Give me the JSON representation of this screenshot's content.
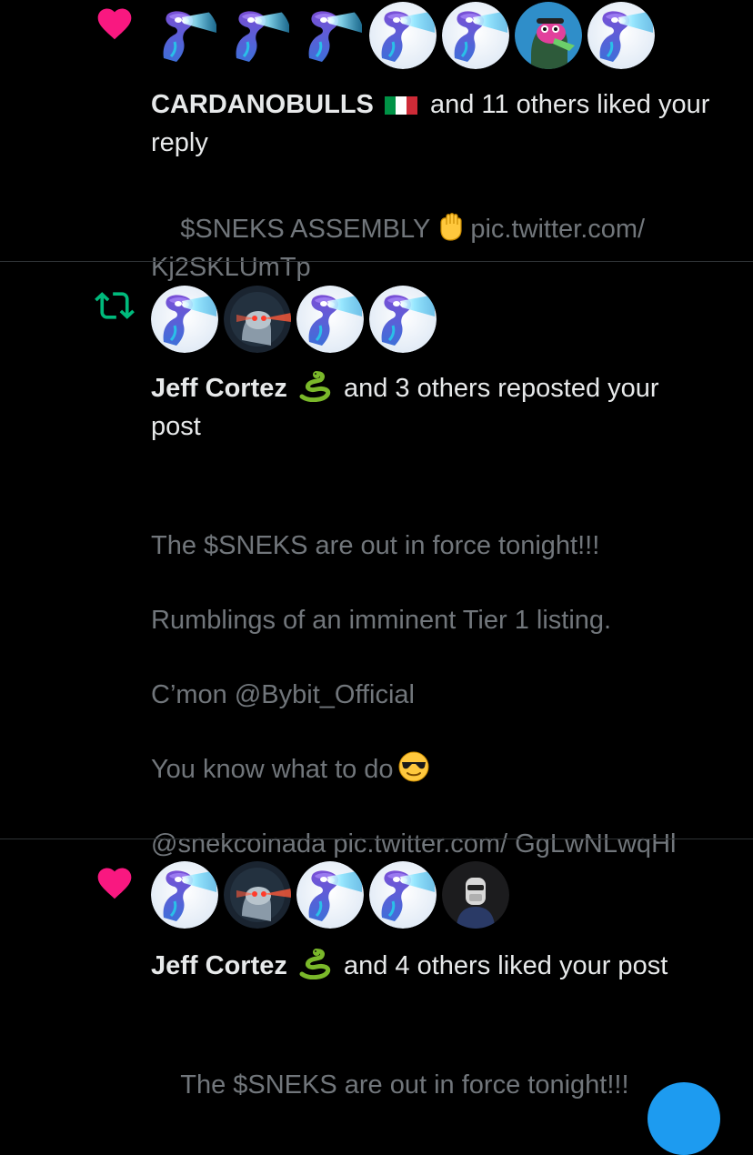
{
  "colors": {
    "background": "#000000",
    "primary_text": "#e7e9ea",
    "secondary_text": "#71767b",
    "like": "#f91880",
    "repost": "#00ba7c",
    "divider": "#2f3336"
  },
  "notifications": [
    {
      "type": "like",
      "icon": "heart-icon",
      "avatars": [
        "snake-eyes-avatar",
        "snake-eyes-avatar",
        "snake-eyes-avatar",
        "snake-eyes-avatar",
        "snake-eyes-avatar",
        "pink-frog-avatar",
        "snake-eyes-avatar"
      ],
      "actor": "CARDANOBULLS",
      "actor_emoji": "italy-flag",
      "action": "and 11 others liked your reply",
      "content": [
        "$SNEKS ASSEMBLY",
        "pic.twitter.com/ Kj2SKLUmTp"
      ]
    },
    {
      "type": "repost",
      "icon": "repost-icon",
      "avatars": [
        "snake-eyes-avatar",
        "laser-eyes-avatar",
        "snake-eyes-avatar",
        "snake-eyes-avatar"
      ],
      "actor": "Jeff Cortez",
      "actor_emoji": "snake-emoji",
      "action": "and 3 others reposted your post",
      "content": [
        "The $SNEKS are out in force tonight!!!",
        "Rumblings of an imminent Tier 1 listing.",
        "C’mon @Bybit_Official",
        "You know what to do",
        "@snekcoinada pic.twitter.com/ GgLwNLwqHl"
      ]
    },
    {
      "type": "like",
      "icon": "heart-icon",
      "avatars": [
        "snake-eyes-avatar",
        "laser-eyes-avatar",
        "snake-eyes-avatar",
        "snake-eyes-avatar",
        "masked-figure-avatar"
      ],
      "actor": "Jeff Cortez",
      "actor_emoji": "snake-emoji",
      "action": "and 4 others liked your post",
      "content": [
        "The $SNEKS are out in force tonight!!!"
      ]
    }
  ]
}
